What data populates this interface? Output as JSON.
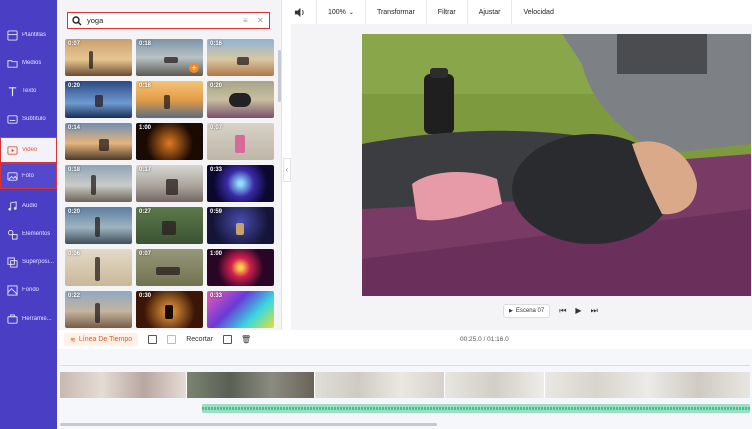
{
  "sidebar": {
    "items": [
      {
        "label": "Plantillas",
        "icon": "template-icon"
      },
      {
        "label": "Medios",
        "icon": "folder-icon"
      },
      {
        "label": "Texto",
        "icon": "text-icon"
      },
      {
        "label": "Subtítulo",
        "icon": "subtitle-icon"
      },
      {
        "label": "Video",
        "icon": "video-icon"
      },
      {
        "label": "Foto",
        "icon": "photo-icon"
      },
      {
        "label": "Audio",
        "icon": "music-icon"
      },
      {
        "label": "Elementos",
        "icon": "elements-icon"
      },
      {
        "label": "Superposi...",
        "icon": "overlay-icon"
      },
      {
        "label": "Fondo",
        "icon": "background-icon"
      },
      {
        "label": "Herramie...",
        "icon": "tools-icon"
      }
    ],
    "active_index": 4,
    "accent_color": "#4a3fc4"
  },
  "search": {
    "value": "yoga"
  },
  "thumbnails": [
    {
      "duration": "0:07"
    },
    {
      "duration": "0:18"
    },
    {
      "duration": "0:16"
    },
    {
      "duration": "0:20"
    },
    {
      "duration": "0:16"
    },
    {
      "duration": "0:20"
    },
    {
      "duration": "0:14"
    },
    {
      "duration": "1:00"
    },
    {
      "duration": "0:07"
    },
    {
      "duration": "0:18"
    },
    {
      "duration": "0:17"
    },
    {
      "duration": "0:33"
    },
    {
      "duration": "0:20"
    },
    {
      "duration": "0:27"
    },
    {
      "duration": "0:59"
    },
    {
      "duration": "0:06"
    },
    {
      "duration": "0:07"
    },
    {
      "duration": "1:00"
    },
    {
      "duration": "0:22"
    },
    {
      "duration": "0:30"
    },
    {
      "duration": "0:33"
    }
  ],
  "toolbar": {
    "zoom": "100%",
    "transform_label": "Transformar",
    "filter_label": "Filtrar",
    "adjust_label": "Ajustar",
    "speed_label": "Velocidad"
  },
  "player": {
    "scene_label": "Escena 07"
  },
  "timeline": {
    "tab_label": "Línea De Tiempo",
    "crop_label": "Recortar",
    "time_display": "00:25.0 / 01:16.0"
  }
}
